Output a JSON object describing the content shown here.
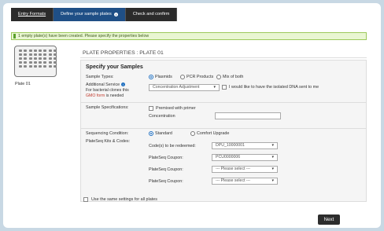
{
  "tabs": [
    {
      "label": "Entry Formats"
    },
    {
      "label": "Define your sample plates"
    },
    {
      "label": "Check and confirm"
    }
  ],
  "alert": "1 empty plate(s) have been created. Please specify the properties below",
  "plate": {
    "label": "Plate 01"
  },
  "panel": {
    "title": "PLATE PROPERTIES : PLATE 01",
    "specify": "Specify your Samples",
    "sample_types": {
      "label": "Sample Types:",
      "options": [
        "Plasmids",
        "PCR Products",
        "Mix of both"
      ],
      "selected": "Plasmids"
    },
    "additional": {
      "label": "Additional Service",
      "note_pre": "For bacterial clones this",
      "note_link": "GMO form",
      "note_post": "is needed",
      "select_value": "Concentration Adjustment",
      "checkbox_label": "I would like to have the isolated DNA sent to me"
    },
    "specs": {
      "label": "Sample Specifications:",
      "premixed": "Premixed with primer",
      "concentration": "Concentration"
    },
    "seq_condition": {
      "label": "Sequencing Condition:",
      "options": [
        "Standard",
        "Comfort Upgrade"
      ],
      "selected": "Standard"
    },
    "kits": {
      "label": "PlateSeq Kits & Codes:",
      "rows": [
        {
          "label": "Code(s) to be redeemed:",
          "value": "DPU_10000001"
        },
        {
          "label": "PlateSeq Coupon:",
          "value": "PCU0000006"
        },
        {
          "label": "PlateSeq Coupon:",
          "value": "--- Please select ---"
        },
        {
          "label": "PlateSeq Coupon:",
          "value": "--- Please select ---"
        }
      ]
    },
    "same_settings": "Use the same settings for all plates"
  },
  "next_label": "Next",
  "icons": {
    "tab_info": "info-icon",
    "dropdown": "chevron-down-icon",
    "plate": "plate-icon"
  },
  "colors": {
    "active_tab": "#1f4f86",
    "alert_bg": "#e9f6d2",
    "link": "#c0392b"
  }
}
